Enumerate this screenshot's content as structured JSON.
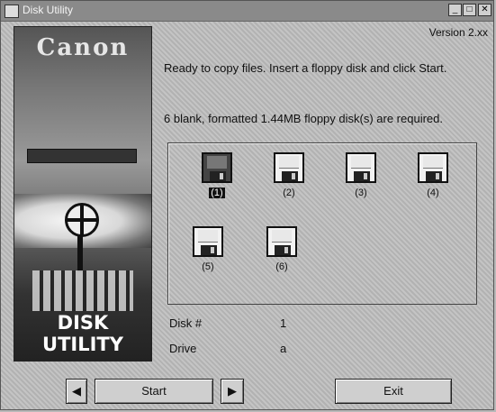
{
  "window": {
    "title": "Disk Utility",
    "controls": {
      "minimize": "_",
      "maximize": "□",
      "close": "✕"
    }
  },
  "banner": {
    "brand": "Canon",
    "logo_text": "DISK UTILITY"
  },
  "version": "Version 2.xx",
  "messages": {
    "instruction": "Ready to copy files. Insert a floppy disk and click Start.",
    "requirement": "6 blank, formatted 1.44MB floppy disk(s) are required."
  },
  "disks": [
    {
      "label": "(1)",
      "active": true
    },
    {
      "label": "(2)",
      "active": false
    },
    {
      "label": "(3)",
      "active": false
    },
    {
      "label": "(4)",
      "active": false
    },
    {
      "label": "(5)",
      "active": false
    },
    {
      "label": "(6)",
      "active": false
    }
  ],
  "fields": {
    "disk_label": "Disk #",
    "disk_value": "1",
    "drive_label": "Drive",
    "drive_value": "a"
  },
  "buttons": {
    "prev": "◀",
    "start": "Start",
    "next": "▶",
    "exit": "Exit"
  },
  "icons": [
    "app-icon",
    "floppy-disk-icon"
  ]
}
